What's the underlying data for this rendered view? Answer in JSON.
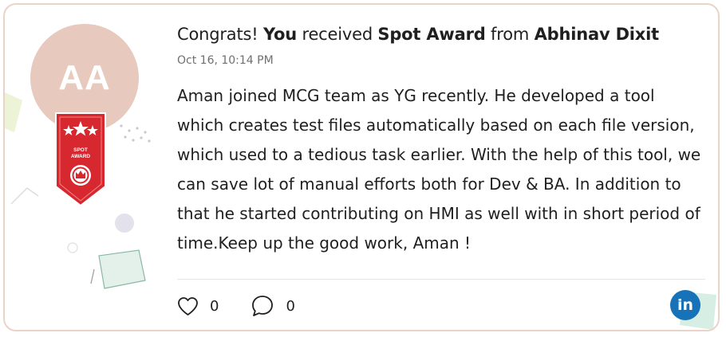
{
  "avatar": {
    "initials": "AA"
  },
  "badge": {
    "line1": "SPOT",
    "line2": "AWARD"
  },
  "headline": {
    "prefix": "Congrats! ",
    "recipient": "You",
    "verb": " received ",
    "award": "Spot Award",
    "from_word": " from ",
    "sender": "Abhinav Dixit"
  },
  "timestamp": "Oct 16, 10:14 PM",
  "message": "Aman joined MCG team as YG recently. He developed a tool which creates test files automatically based on each file version, which used to a tedious task earlier. With the help of this tool, we can save lot of manual efforts both for Dev & BA. In addition to that he started contributing on HMI as well with in short period of time.Keep up the good work, Aman !",
  "actions": {
    "likes": "0",
    "comments": "0",
    "like_icon": "heart-icon",
    "comment_icon": "comment-bubble-icon"
  },
  "share": {
    "label": "in",
    "icon": "linkedin-icon"
  },
  "colors": {
    "avatar_bg": "#e7c9bd",
    "badge_red": "#d7272f",
    "card_border": "#ead3c8",
    "linkedin_blue": "#1772b8"
  }
}
